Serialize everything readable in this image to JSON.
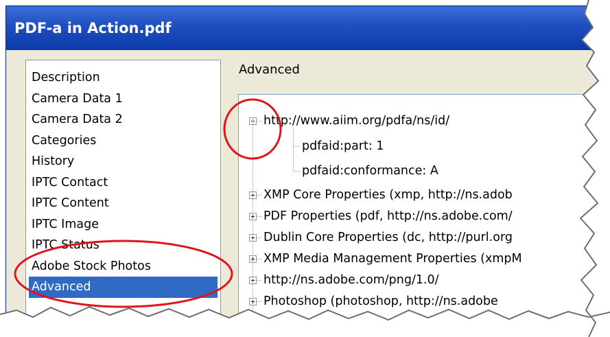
{
  "window": {
    "title": "PDF-a in Action.pdf"
  },
  "sidebar": {
    "items": [
      {
        "label": "Description"
      },
      {
        "label": "Camera Data 1"
      },
      {
        "label": "Camera Data 2"
      },
      {
        "label": "Categories"
      },
      {
        "label": "History"
      },
      {
        "label": "IPTC Contact"
      },
      {
        "label": "IPTC Content"
      },
      {
        "label": "IPTC Image"
      },
      {
        "label": "IPTC Status"
      },
      {
        "label": "Adobe Stock Photos"
      },
      {
        "label": "Advanced",
        "selected": true
      }
    ]
  },
  "main": {
    "section_title": "Advanced",
    "tree": {
      "expanded_node": {
        "label": "http://www.aiim.org/pdfa/ns/id/",
        "children": [
          {
            "label": "pdfaid:part: 1"
          },
          {
            "label": "pdfaid:conformance: A"
          }
        ]
      },
      "collapsed_nodes": [
        {
          "label": "XMP Core Properties (xmp, http://ns.adob"
        },
        {
          "label": "PDF Properties (pdf, http://ns.adobe.com/"
        },
        {
          "label": "Dublin Core Properties (dc, http://purl.org"
        },
        {
          "label": "XMP Media Management Properties (xmpM"
        },
        {
          "label": "http://ns.adobe.com/png/1.0/"
        },
        {
          "label": "Photoshop (photoshop, http://ns.adobe"
        }
      ]
    }
  },
  "colors": {
    "titlebar": "#1f4fbf",
    "selection": "#316ac5",
    "annotation": "#e0141e",
    "window_bg": "#ece9d8"
  },
  "icons": {
    "expanded": "minus-box-icon",
    "collapsed": "plus-box-icon"
  }
}
